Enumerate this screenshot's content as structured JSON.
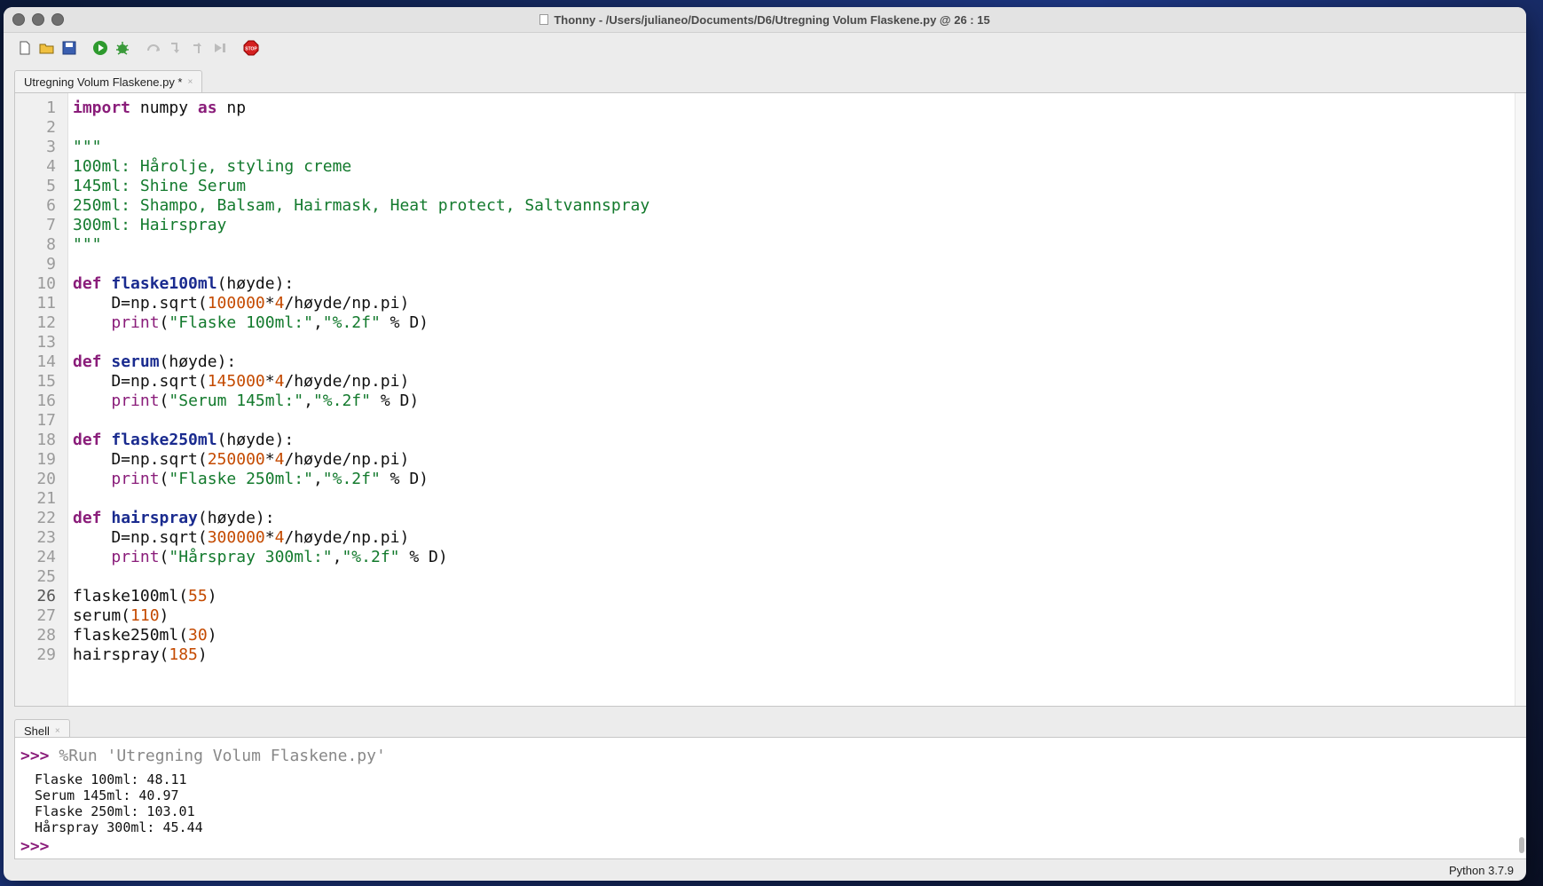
{
  "window": {
    "title": "Thonny  -  /Users/julianeo/Documents/D6/Utregning Volum Flaskene.py  @  26 : 15"
  },
  "toolbar": {
    "icons": [
      "new-file-icon",
      "open-file-icon",
      "save-icon",
      "run-icon",
      "debug-icon",
      "step-over-icon",
      "step-into-icon",
      "step-out-icon",
      "resume-icon",
      "stop-icon"
    ]
  },
  "editor": {
    "tab_label": "Utregning Volum Flaskene.py *",
    "current_line": 26,
    "line_numbers": [
      "1",
      "2",
      "3",
      "4",
      "5",
      "6",
      "7",
      "8",
      "9",
      "10",
      "11",
      "12",
      "13",
      "14",
      "15",
      "16",
      "17",
      "18",
      "19",
      "20",
      "21",
      "22",
      "23",
      "24",
      "25",
      "26",
      "27",
      "28",
      "29"
    ]
  },
  "shell": {
    "tab_label": "Shell",
    "prompt": ">>>",
    "run_command": "%Run 'Utregning Volum Flaskene.py'",
    "output": [
      "Flaske 100ml: 48.11",
      "Serum 145ml: 40.97",
      "Flaske 250ml: 103.01",
      "Hårspray 300ml: 45.44"
    ]
  },
  "status": {
    "python_version": "Python 3.7.9"
  },
  "colors": {
    "keyword": "#8a1d7a",
    "function_name": "#1a2b8f",
    "string": "#137a2d",
    "number": "#c44a00"
  }
}
